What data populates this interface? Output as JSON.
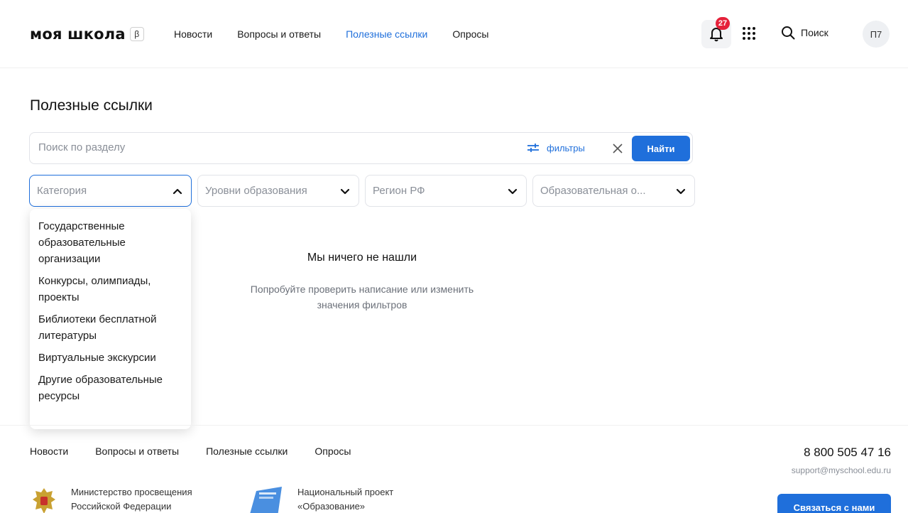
{
  "header": {
    "logo": "моя школа",
    "beta": "β",
    "nav": [
      "Новости",
      "Вопросы и ответы",
      "Полезные ссылки",
      "Опросы"
    ],
    "active_nav": "Полезные ссылки",
    "notifications_count": "27",
    "search_label": "Поиск",
    "avatar_initials": "П7"
  },
  "main": {
    "title": "Полезные ссылки",
    "search_placeholder": "Поиск по разделу",
    "filters_label": "фильтры",
    "find_label": "Найти",
    "selects": {
      "category": "Категория",
      "levels": "Уровни образования",
      "region": "Регион РФ",
      "org": "Образовательная о..."
    },
    "category_options": [
      "Государственные образовательные организации",
      "Конкурсы, олимпиады, проекты",
      "Библиотеки бесплатной литературы",
      "Виртуальные экскурсии",
      "Другие образовательные ресурсы"
    ],
    "empty_title": "Мы ничего не нашли",
    "empty_subtitle": "Попробуйте проверить написание или изменить значения фильтров"
  },
  "footer": {
    "nav": [
      "Новости",
      "Вопросы и ответы",
      "Полезные ссылки",
      "Опросы"
    ],
    "phone": "8 800 505 47 16",
    "email": "support@myschool.edu.ru",
    "org1_line1": "Министерство просвещения",
    "org1_line2": "Российской Федерации",
    "org2_line1": "Национальный проект",
    "org2_line2": "«Образование»",
    "contact_label": "Связаться с нами"
  },
  "colors": {
    "accent": "#1f6fdb",
    "badge": "#e5213a"
  }
}
